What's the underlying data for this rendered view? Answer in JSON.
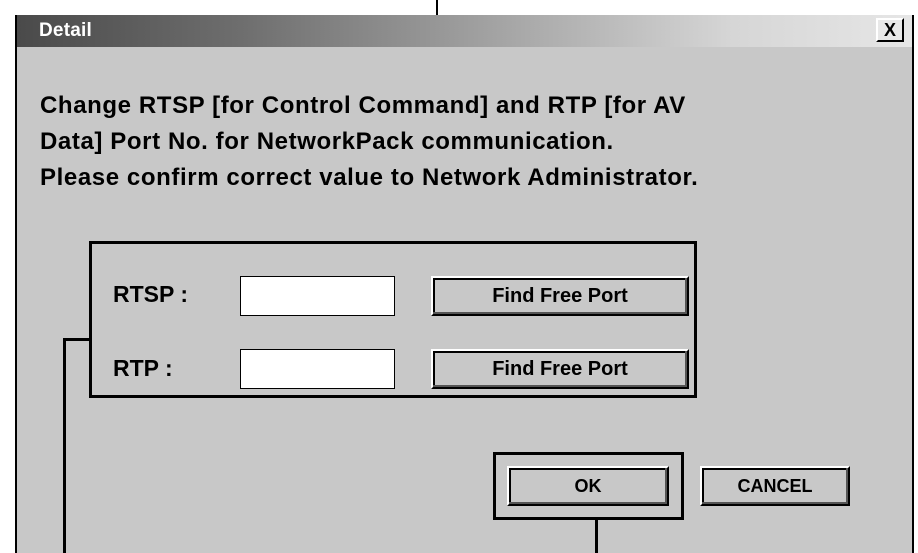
{
  "dialog": {
    "title": "Detail",
    "close_label": "X",
    "message_lines": [
      "Change RTSP [for Control Command] and RTP [for AV",
      "Data] Port No. for NetworkPack communication.",
      "Please confirm correct value to Network Administrator."
    ]
  },
  "ports": {
    "rtsp_label": "RTSP :",
    "rtsp_value": "",
    "rtp_label": "RTP :",
    "rtp_value": "",
    "find_free_port_label": "Find Free Port"
  },
  "footer": {
    "ok_label": "OK",
    "cancel_label": "CANCEL"
  },
  "colors": {
    "dialog_bg": "#c8c8c8",
    "title_start": "#4a4a4a",
    "title_end": "#e6e6e6"
  }
}
